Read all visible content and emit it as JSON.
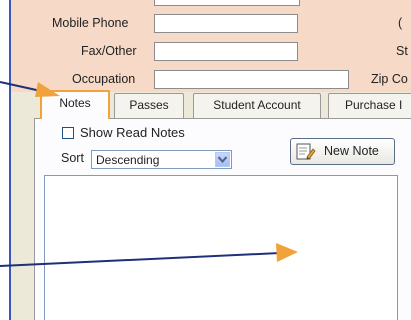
{
  "contact_form": {
    "mobile_phone_label": "Mobile Phone",
    "mobile_phone_value": "",
    "fax_other_label": "Fax/Other",
    "fax_other_value": "",
    "occupation_label": "Occupation",
    "occupation_value": "",
    "right_col_label_1": "(",
    "right_col_label_2": "St",
    "right_col_label_3": "Zip Co"
  },
  "tabs": [
    {
      "label": "Notes",
      "active": true
    },
    {
      "label": "Passes"
    },
    {
      "label": "Student Account"
    },
    {
      "label": "Purchase I"
    }
  ],
  "notes_panel": {
    "show_read_notes_label": "Show Read Notes",
    "show_read_notes_checked": false,
    "sort_label": "Sort",
    "sort_value": "Descending",
    "new_note_label": "New Note",
    "notes_text": ""
  },
  "colors": {
    "accent_arrow": "#f2a23a",
    "arrow_line": "#1f2f7a",
    "form_background": "#f6d9c6",
    "tab_panel_background": "#ece9d8",
    "frame_border": "#3b57b7"
  },
  "icons": {
    "new_note_icon": "note-pencil-icon",
    "dropdown_icon": "chevron-down-icon"
  }
}
